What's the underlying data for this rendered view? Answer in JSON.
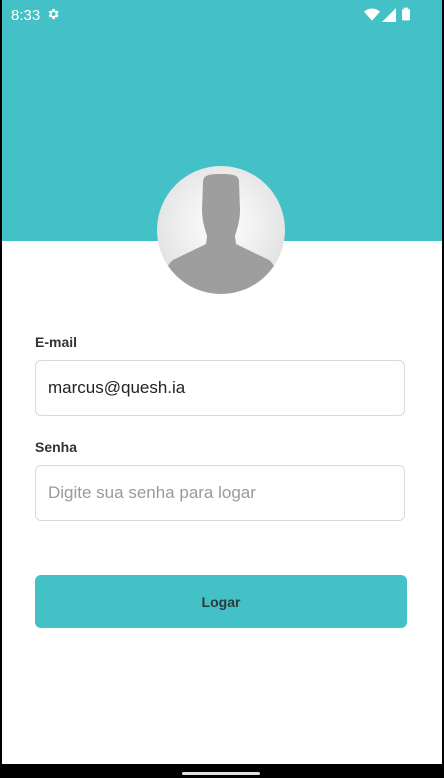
{
  "status_bar": {
    "time": "8:33",
    "icons": [
      "gear-icon",
      "wifi-icon",
      "signal-icon",
      "battery-icon"
    ]
  },
  "header": {
    "background_color": "#43c1c7"
  },
  "avatar": {
    "icon": "default-user-avatar-icon"
  },
  "form": {
    "email_label": "E-mail",
    "email_value": "marcus@quesh.ia",
    "password_label": "Senha",
    "password_value": "",
    "password_placeholder": "Digite sua senha para logar",
    "submit_label": "Logar"
  },
  "colors": {
    "accent": "#43c1c7",
    "text_dark": "#333333",
    "field_border": "#d9d9d9",
    "placeholder": "#9a9a9a"
  }
}
